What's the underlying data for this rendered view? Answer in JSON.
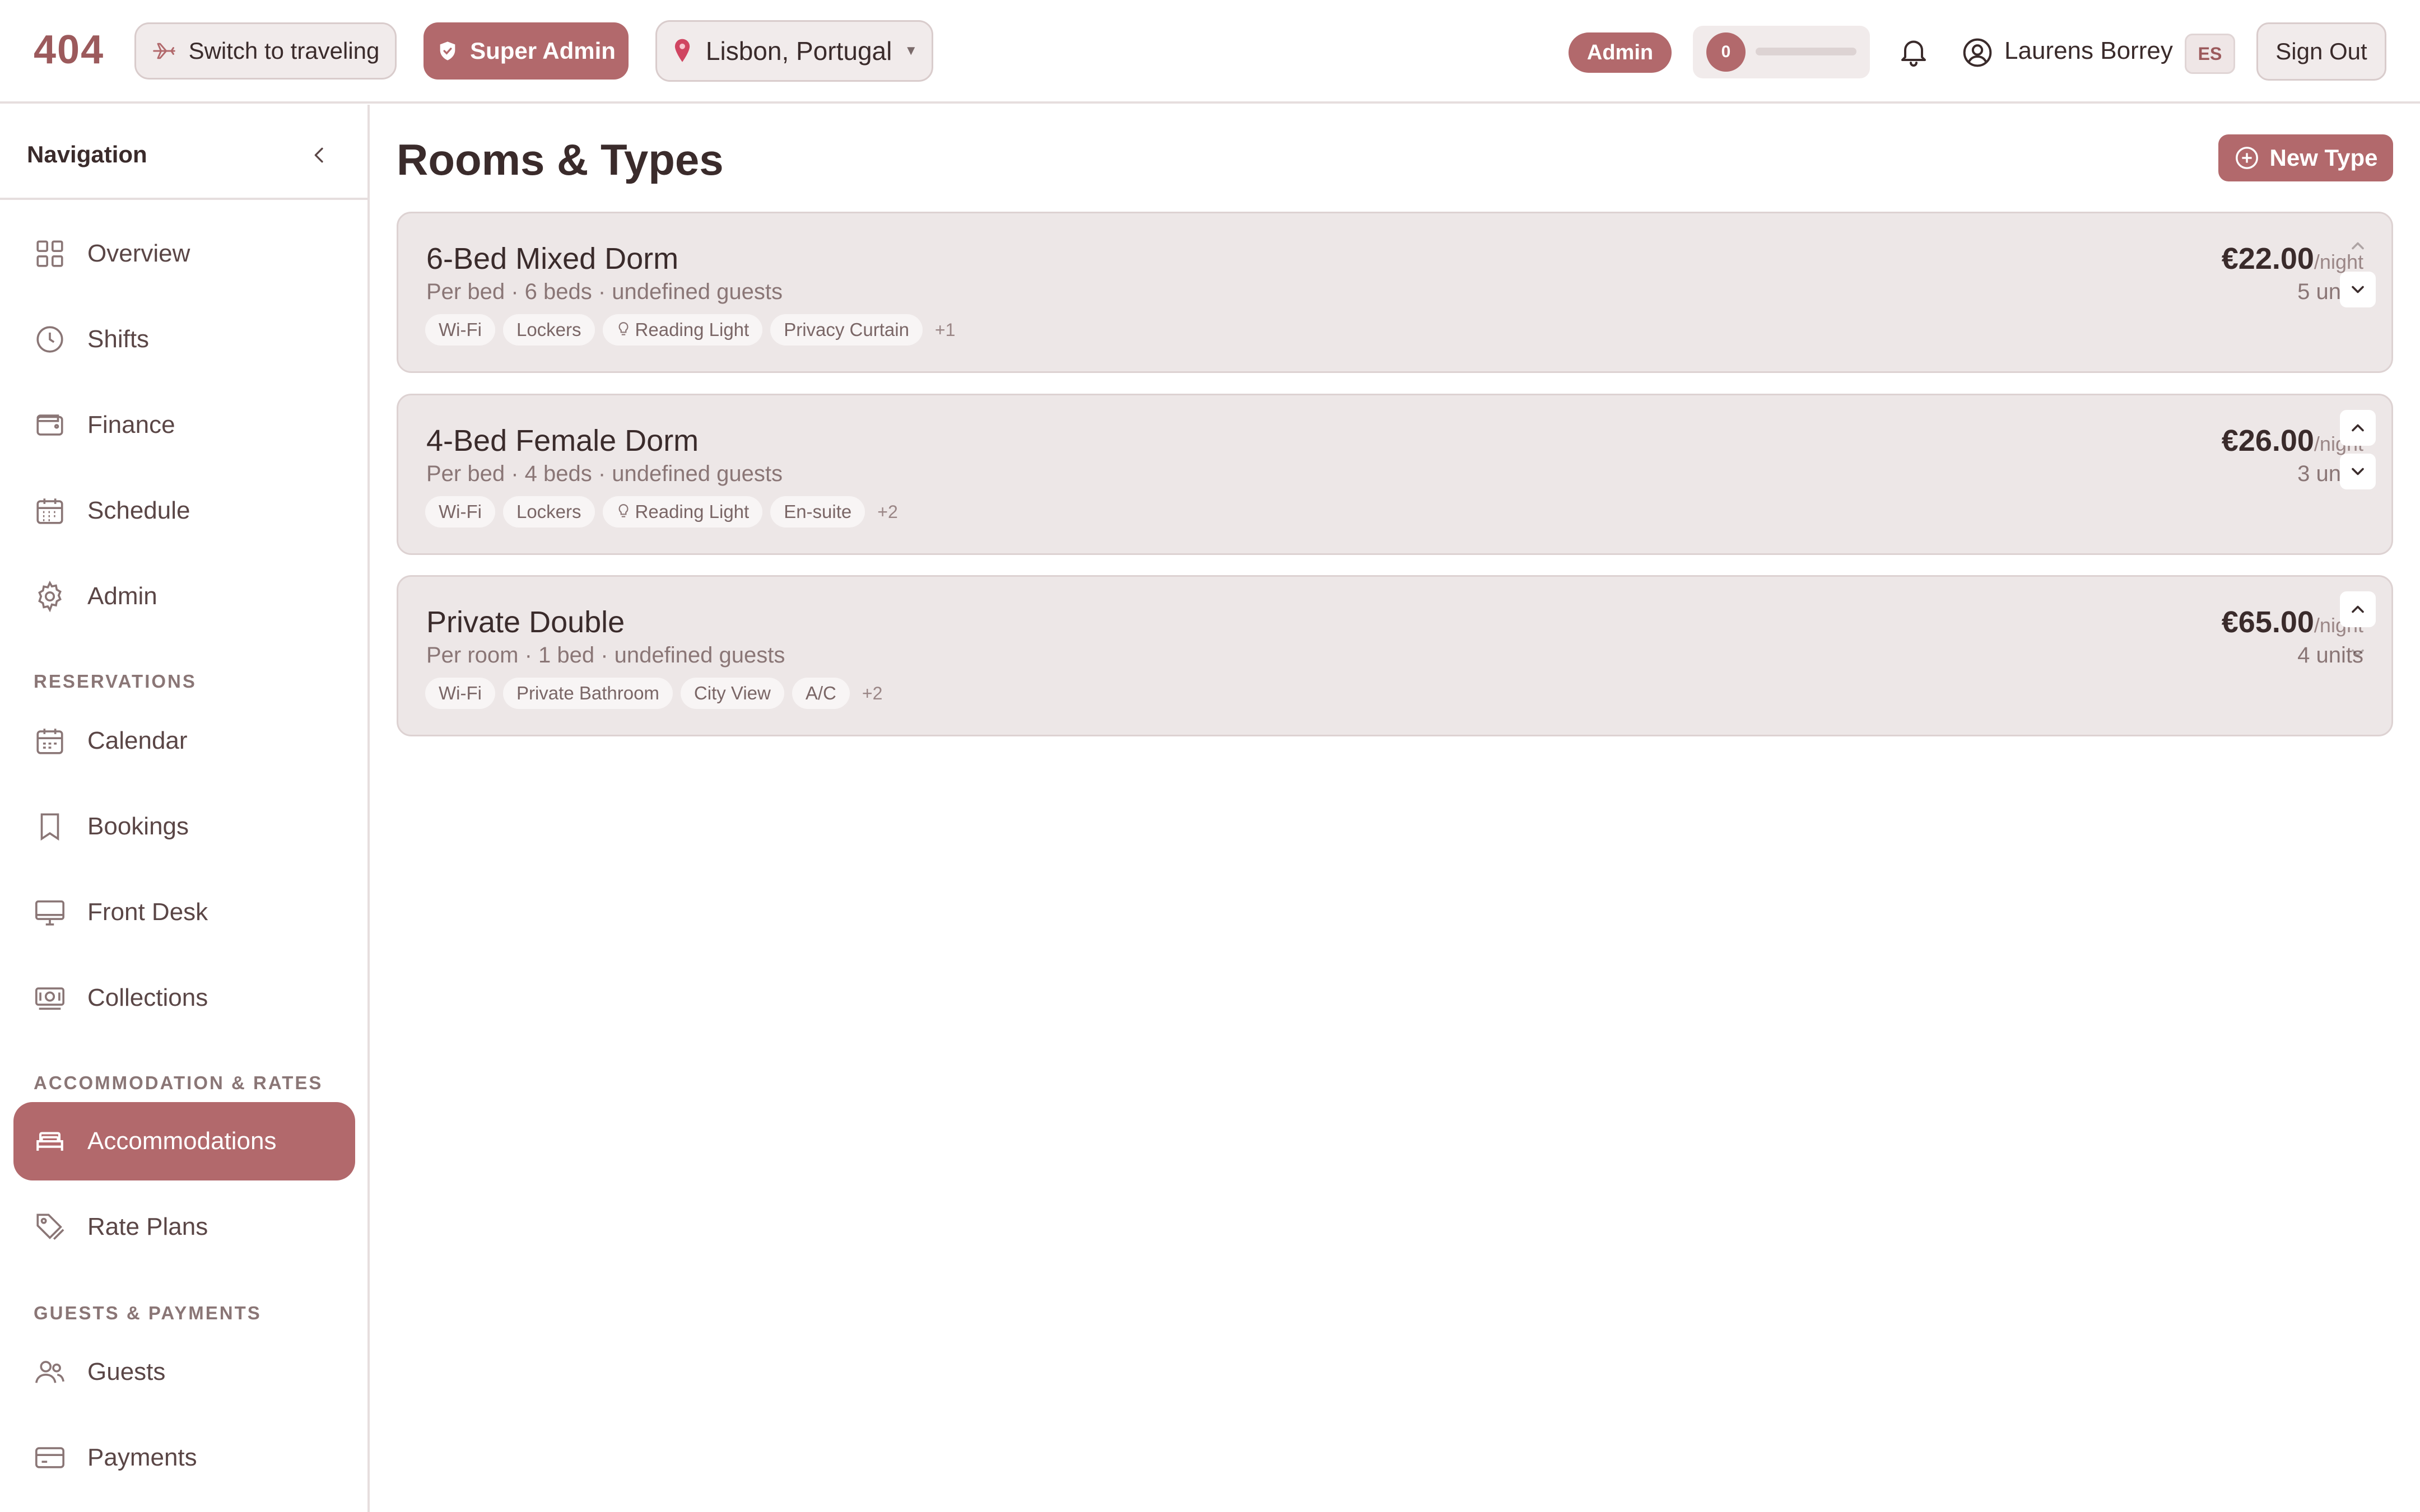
{
  "app": {
    "logo": "404"
  },
  "topbar": {
    "switch_label": "Switch to traveling",
    "role_label": "Super Admin",
    "location": "Lisbon, Portugal",
    "admin_badge": "Admin",
    "progress_count": "0",
    "progress_fraction": 0,
    "user_name": "Laurens Borrey",
    "language": "ES",
    "signout_label": "Sign Out"
  },
  "sidebar": {
    "title": "Navigation",
    "main": [
      {
        "label": "Overview",
        "icon": "grid-icon"
      },
      {
        "label": "Shifts",
        "icon": "clock-icon"
      },
      {
        "label": "Finance",
        "icon": "wallet-icon"
      },
      {
        "label": "Schedule",
        "icon": "calendar-grid-icon"
      },
      {
        "label": "Admin",
        "icon": "gear-icon"
      }
    ],
    "sections": [
      {
        "label": "RESERVATIONS",
        "items": [
          {
            "label": "Calendar",
            "icon": "calendar-icon"
          },
          {
            "label": "Bookings",
            "icon": "bookmark-icon"
          },
          {
            "label": "Front Desk",
            "icon": "monitor-icon"
          },
          {
            "label": "Collections",
            "icon": "banknote-icon"
          }
        ]
      },
      {
        "label": "ACCOMMODATION & RATES",
        "items": [
          {
            "label": "Accommodations",
            "icon": "bed-icon",
            "active": true
          },
          {
            "label": "Rate Plans",
            "icon": "tag-icon"
          }
        ]
      },
      {
        "label": "GUESTS & PAYMENTS",
        "items": [
          {
            "label": "Guests",
            "icon": "users-icon"
          },
          {
            "label": "Payments",
            "icon": "credit-card-icon"
          }
        ]
      }
    ]
  },
  "main": {
    "title": "Rooms & Types",
    "new_button": "New Type",
    "rooms": [
      {
        "name": "6-Bed Mixed Dorm",
        "subtitle": "Per bed · 6 beds · undefined guests",
        "amenities": [
          "Wi-Fi",
          "Lockers",
          "Reading Light",
          "Privacy Curtain"
        ],
        "more": "+1",
        "price": "€22.00",
        "per": "/night",
        "units": "5 units"
      },
      {
        "name": "4-Bed Female Dorm",
        "subtitle": "Per bed · 4 beds · undefined guests",
        "amenities": [
          "Wi-Fi",
          "Lockers",
          "Reading Light",
          "En-suite"
        ],
        "more": "+2",
        "price": "€26.00",
        "per": "/night",
        "units": "3 units"
      },
      {
        "name": "Private Double",
        "subtitle": "Per room · 1 bed · undefined guests",
        "amenities": [
          "Wi-Fi",
          "Private Bathroom",
          "City View",
          "A/C"
        ],
        "more": "+2",
        "price": "€65.00",
        "per": "/night",
        "units": "4 units"
      }
    ]
  },
  "colors": {
    "accent": "#b2696c",
    "card": "#ede7e7",
    "text": "#3a2b2b"
  }
}
